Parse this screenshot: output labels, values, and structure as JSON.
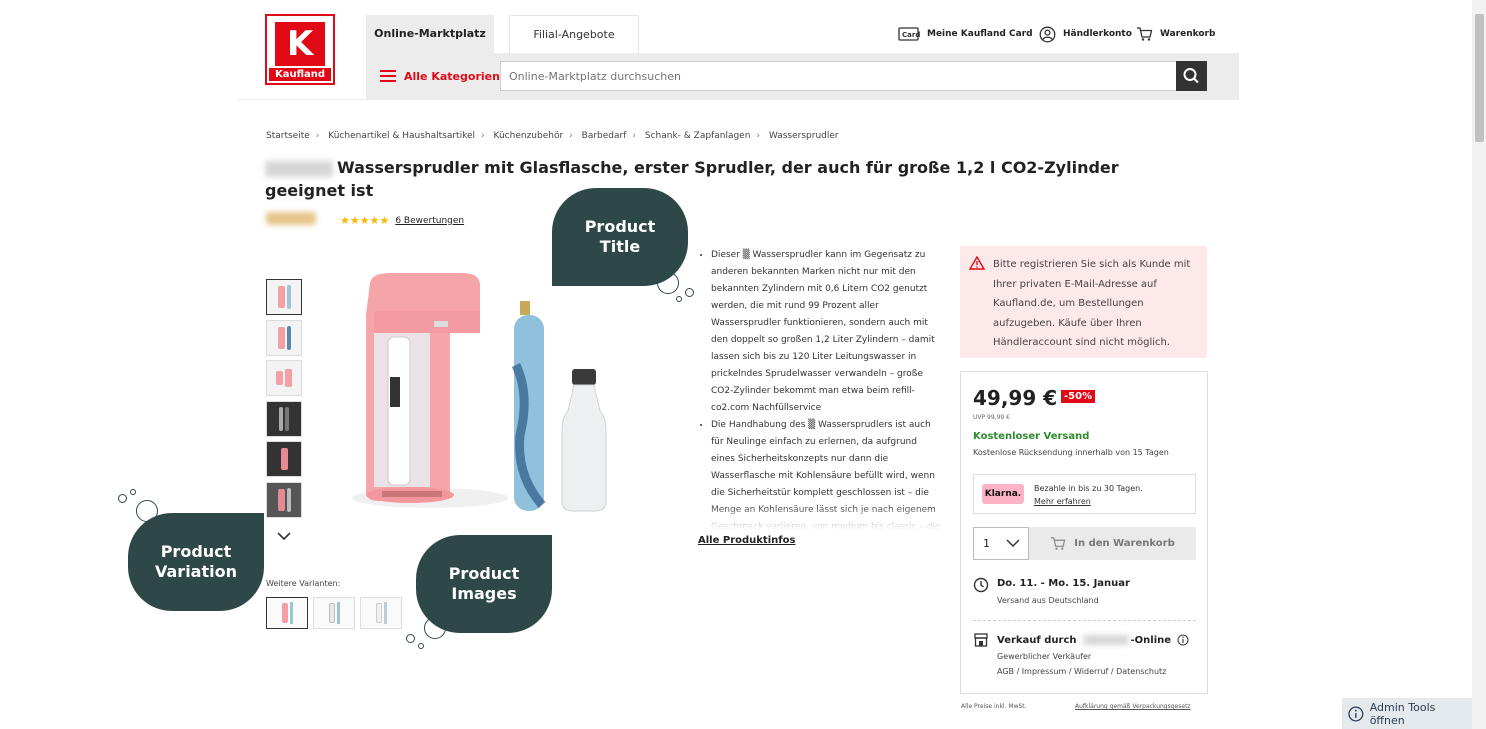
{
  "header": {
    "logo_text": "Kaufland",
    "tabs": [
      "Online-Marktplatz",
      "Filial-Angebote"
    ],
    "categories_label": "Alle Kategorien",
    "search_placeholder": "Online-Marktplatz durchsuchen",
    "card_label": "Meine Kaufland Card",
    "account_label": "Händlerkonto",
    "cart_label": "Warenkorb"
  },
  "breadcrumb": [
    "Startseite",
    "Küchenartikel & Haushaltsartikel",
    "Küchenzubehör",
    "Barbedarf",
    "Schank- & Zapfanlagen",
    "Wassersprudler"
  ],
  "product": {
    "title": "Wassersprudler mit Glasflasche, erster Sprudler, der auch für große 1,2 l CO2-Zylinder geeignet ist",
    "rating_stars": "★★★★★",
    "reviews_label": "6 Bewertungen",
    "variants_label": "Weitere Varianten:",
    "description": [
      "Dieser ▒ Wassersprudler kann im Gegensatz zu anderen bekannten Marken nicht nur mit den bekannten Zylindern mit 0,6 Litern CO2 genutzt werden, die mit rund 99 Prozent aller Wassersprudler funktionieren, sondern auch mit den doppelt so großen 1,2 Liter Zylindern – damit lassen sich bis zu 120 Liter Leitungswasser in prickelndes Sprudelwasser verwandeln – große CO2-Zylinder bekommt man etwa beim refill-co2.com Nachfüllservice",
      "Die Handhabung des ▒ Wassersprudlers ist auch für Neulinge einfach zu erlernen, da aufgrund eines Sicherheitskonzepts nur dann die Wasserflasche mit Kohlensäure befüllt wird, wenn die Sicherheitstür komplett geschlossen ist – die Menge an Kohlensäure lässt sich je nach eigenem Geschmack variieren, von medium bis classic – die"
    ],
    "all_info_label": "Alle Produktinfos"
  },
  "callouts": {
    "title": "Product Title",
    "variation": "Product Variation",
    "images": "Product Images"
  },
  "notice": {
    "text": "Bitte registrieren Sie sich als Kunde mit Ihrer privaten E-Mail-Adresse auf Kaufland.de, um Bestellungen aufzugeben. Käufe über Ihren Händleraccount sind nicht möglich."
  },
  "buybox": {
    "price": "49,99 €",
    "discount": "-50%",
    "uvp": "UVP 99,99 €",
    "shipping": "Kostenloser Versand",
    "returns": "Kostenlose Rücksendung innerhalb von 15 Tagen",
    "klarna_badge": "Klarna.",
    "klarna_text": "Bezahle in bis zu 30 Tagen.",
    "klarna_link": "Mehr erfahren",
    "quantity": "1",
    "add_to_cart": "In den Warenkorb",
    "delivery_date": "Do. 11. - Mo. 15. Januar",
    "delivery_from": "Versand aus Deutschland",
    "seller_prefix": "Verkauf durch",
    "seller_suffix": "-Online",
    "seller_type": "Gewerblicher Verkäufer",
    "seller_links": "AGB / Impressum / Widerruf / Datenschutz"
  },
  "footer": {
    "prices_note": "Alle Preise inkl. MwSt.",
    "packaging_link": "Aufklärung gemäß Verpackungsgesetz"
  },
  "admin": {
    "label": "Admin Tools öffnen"
  },
  "colors": {
    "brand_red": "#e10915",
    "callout": "#2e4848",
    "success": "#2e8b2e",
    "notice_bg": "#fde8ea"
  }
}
